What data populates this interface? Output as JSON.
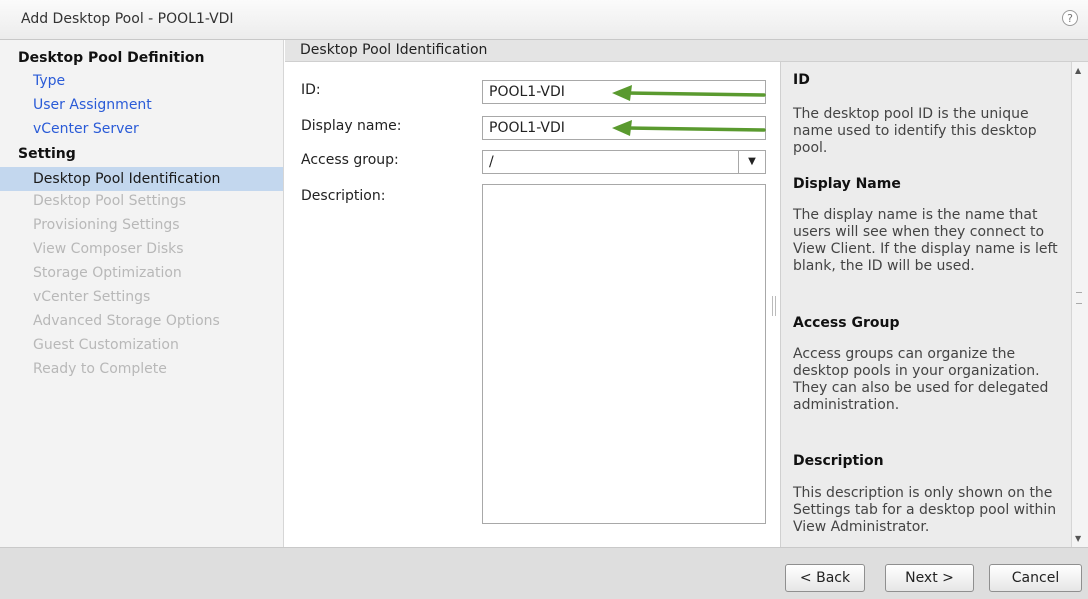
{
  "window": {
    "title": "Add Desktop Pool - POOL1-VDI",
    "help_symbol": "?"
  },
  "nav": {
    "groups": [
      {
        "label": "Desktop Pool Definition"
      },
      {
        "label": "Setting"
      }
    ],
    "items": [
      {
        "label": "Type",
        "state": "link"
      },
      {
        "label": "User Assignment",
        "state": "link"
      },
      {
        "label": "vCenter Server",
        "state": "link"
      },
      {
        "label": "Desktop Pool Identification",
        "state": "active"
      },
      {
        "label": "Desktop Pool Settings",
        "state": "disabled"
      },
      {
        "label": "Provisioning Settings",
        "state": "disabled"
      },
      {
        "label": "View Composer Disks",
        "state": "disabled"
      },
      {
        "label": "Storage Optimization",
        "state": "disabled"
      },
      {
        "label": "vCenter Settings",
        "state": "disabled"
      },
      {
        "label": "Advanced Storage Options",
        "state": "disabled"
      },
      {
        "label": "Guest Customization",
        "state": "disabled"
      },
      {
        "label": "Ready to Complete",
        "state": "disabled"
      }
    ]
  },
  "form": {
    "section_title": "Desktop Pool Identification",
    "id_label": "ID:",
    "id_value": "POOL1-VDI",
    "display_name_label": "Display name:",
    "display_name_value": "POOL1-VDI",
    "access_group_label": "Access group:",
    "access_group_value": "/",
    "description_label": "Description:",
    "description_value": ""
  },
  "help": {
    "sections": [
      {
        "heading": "ID",
        "text": "The desktop pool ID is the unique name used to identify this desktop pool."
      },
      {
        "heading": "Display Name",
        "text": "The display name is the name that users will see when they connect to View Client. If the display name is left blank, the ID will be used."
      },
      {
        "heading": "Access Group",
        "text": "Access groups can organize the desktop pools in your organization. They can also be used for delegated administration."
      },
      {
        "heading": "Description",
        "text": "This description is only shown on the Settings tab for a desktop pool within View Administrator."
      }
    ]
  },
  "footer": {
    "back_label": "< Back",
    "next_label": "Next >",
    "cancel_label": "Cancel"
  },
  "colors": {
    "annotation_arrow": "#5a9a2f",
    "nav_active_bg": "#c3d7ee",
    "link": "#2a5bd7"
  },
  "icons": {
    "help": "help-icon",
    "dropdown": "chevron-down-icon"
  }
}
